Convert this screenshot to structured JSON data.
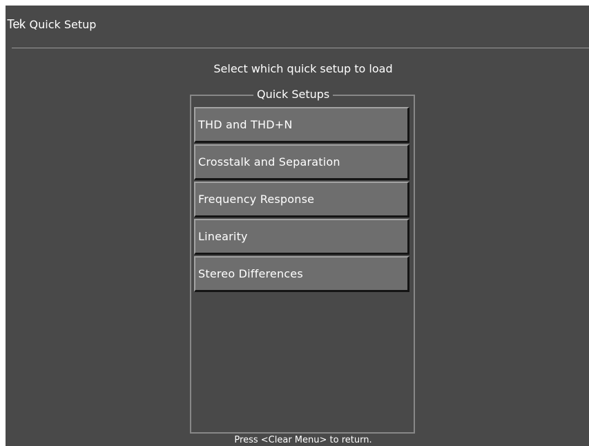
{
  "header": {
    "brand": "Tek",
    "title": "Quick Setup"
  },
  "prompt": "Select which quick setup to load",
  "group": {
    "title": "Quick Setups",
    "items": [
      {
        "label": "THD and THD+N"
      },
      {
        "label": "Crosstalk and Separation"
      },
      {
        "label": "Frequency Response"
      },
      {
        "label": "Linearity"
      },
      {
        "label": "Stereo Differences"
      }
    ]
  },
  "footer": "Press <Clear Menu> to return.",
  "colors": {
    "screen_background": "#494949",
    "button_face": "#6e6e6e",
    "text": "#ffffff"
  }
}
